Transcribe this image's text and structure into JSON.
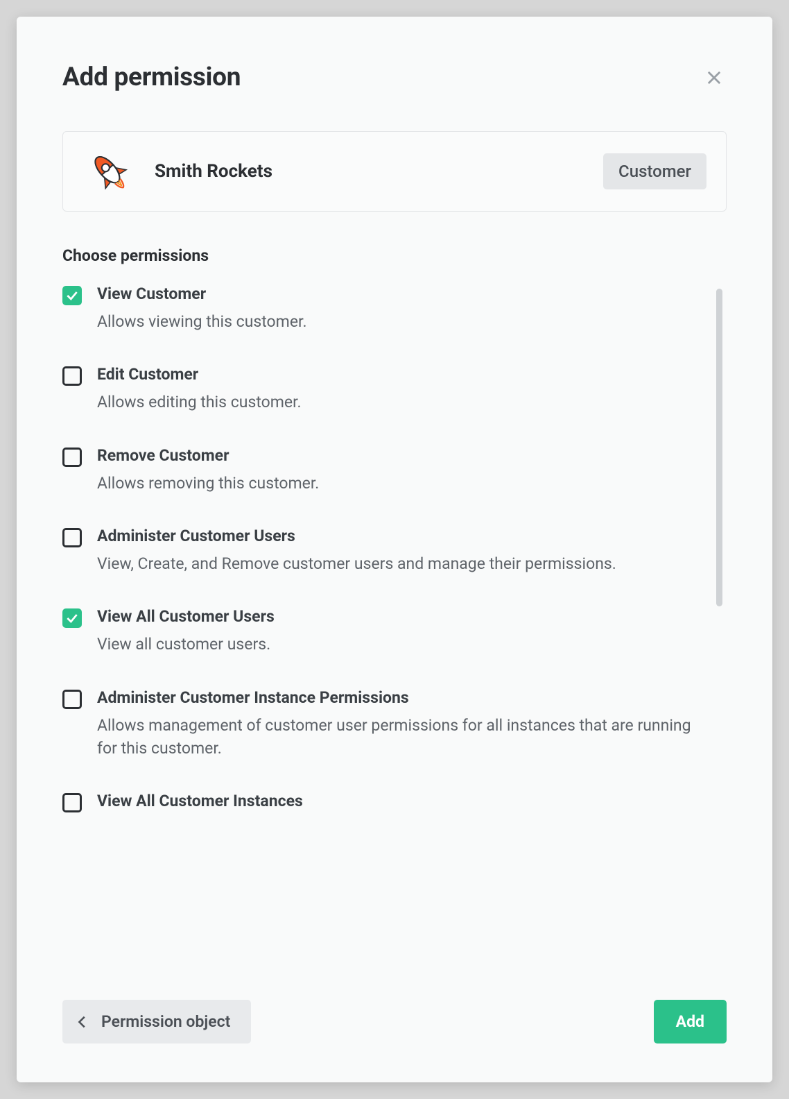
{
  "header": {
    "title": "Add permission"
  },
  "subject": {
    "name": "Smith Rockets",
    "type_badge": "Customer",
    "icon": "rocket-icon"
  },
  "section": {
    "label": "Choose permissions"
  },
  "permissions": [
    {
      "title": "View Customer",
      "description": "Allows viewing this customer.",
      "checked": true
    },
    {
      "title": "Edit Customer",
      "description": "Allows editing this customer.",
      "checked": false
    },
    {
      "title": "Remove Customer",
      "description": "Allows removing this customer.",
      "checked": false
    },
    {
      "title": "Administer Customer Users",
      "description": "View, Create, and Remove customer users and manage their permissions.",
      "checked": false
    },
    {
      "title": "View All Customer Users",
      "description": "View all customer users.",
      "checked": true
    },
    {
      "title": "Administer Customer Instance Permissions",
      "description": "Allows management of customer user permissions for all instances that are running for this customer.",
      "checked": false
    },
    {
      "title": "View All Customer Instances",
      "description": "",
      "checked": false
    }
  ],
  "footer": {
    "back_label": "Permission object",
    "submit_label": "Add"
  }
}
